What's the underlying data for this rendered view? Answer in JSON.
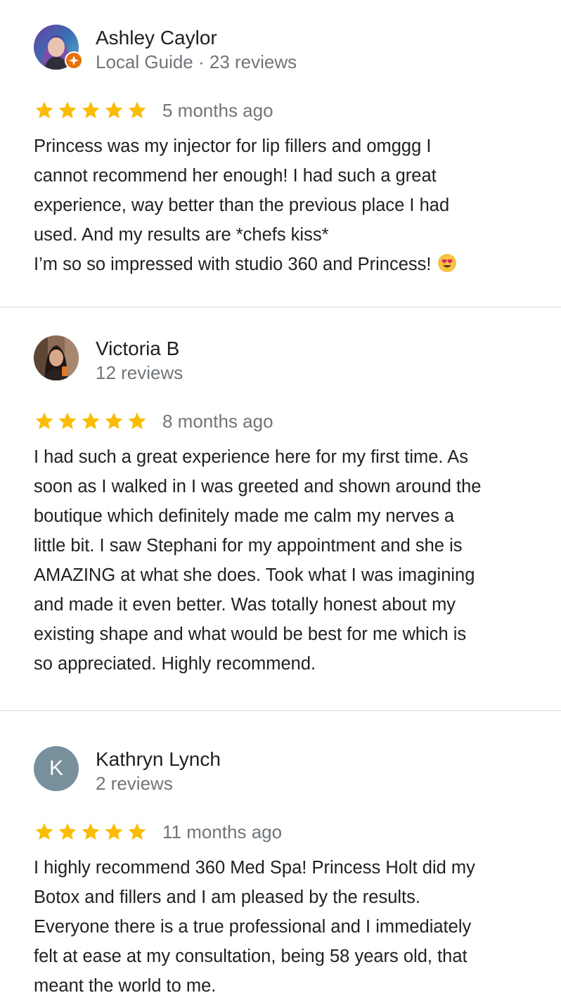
{
  "reviews": [
    {
      "name": "Ashley Caylor",
      "sub": "Local Guide · 23 reviews",
      "rating": 5,
      "time": "5 months ago",
      "text": "Princess was my injector for lip fillers and omggg I\ncannot recommend her enough! I had such a great\nexperience, way better than the previous place I had\nused. And my results are *chefs kiss*\nI’m so so impressed with studio 360 and Princess!",
      "emoji": "heart-eyes-emoji"
    },
    {
      "name": "Victoria B",
      "sub": "12 reviews",
      "rating": 5,
      "time": "8 months ago",
      "text": "I had such a great experience here for my first time. As\nsoon as I walked in I was greeted and shown around the\nboutique which definitely made me calm my nerves a\nlittle bit. I saw Stephani for my appointment and she is\nAMAZING at what she does. Took what I was imagining\nand made it even better. Was totally honest about my\nexisting shape and what would be best for me which is\nso appreciated. Highly recommend."
    },
    {
      "name": "Kathryn Lynch",
      "sub": "2 reviews",
      "avatar_letter": "K",
      "rating": 5,
      "time": "11 months ago",
      "text": "I highly recommend 360 Med Spa! Princess Holt did my\nBotox and fillers and I am pleased by the results.\nEveryone there is a true professional and I immediately\nfelt at ease at my consultation, being 58 years old, that\nmeant the world to me."
    }
  ],
  "colors": {
    "star": "#fbbc04",
    "avatar_letter_bg": "#78909c",
    "local_guide_badge": "#e8710a",
    "divider": "#dadce0"
  }
}
